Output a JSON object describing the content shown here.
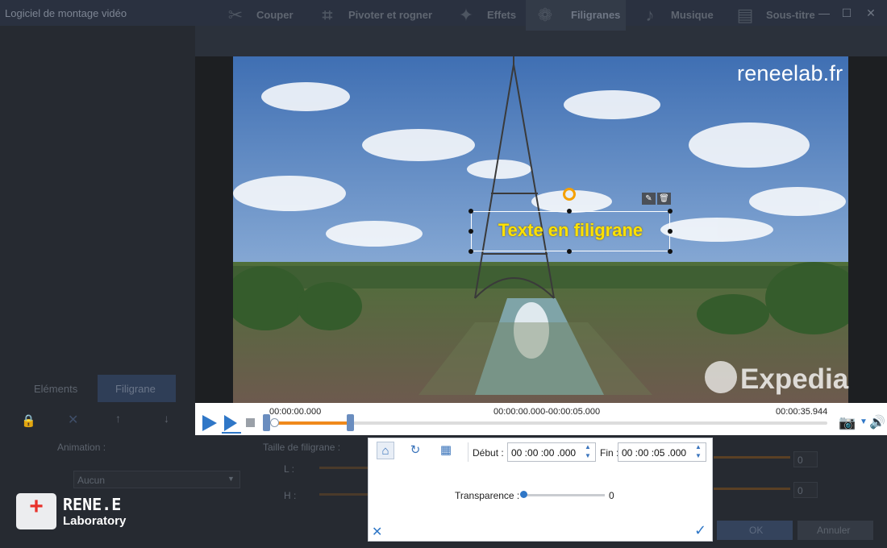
{
  "window": {
    "title": "Logiciel de montage vidéo",
    "min": "—",
    "max": "☐",
    "close": "✕"
  },
  "tabs": [
    {
      "label": "Couper",
      "icon": "scissors-icon"
    },
    {
      "label": "Pivoter et rogner",
      "icon": "crop-icon"
    },
    {
      "label": "Effets",
      "icon": "effects-icon"
    },
    {
      "label": "Filigranes",
      "icon": "watermark-icon"
    },
    {
      "label": "Musique",
      "icon": "music-icon"
    },
    {
      "label": "Sous-titre",
      "icon": "subtitle-icon"
    }
  ],
  "active_tab": "Filigranes",
  "preview": {
    "brand_watermark": "reneelab.fr",
    "video_logo": "Expedia",
    "watermark_text": "Texte en filigrane",
    "colors": {
      "watermark_text": "#ffe100",
      "selection": "#ffffff",
      "rotate_handle": "#f5a000"
    }
  },
  "player": {
    "time_start": "00:00:00.000",
    "time_range": "00:00:00.000-00:00:05.000",
    "time_end": "00:00:35.944",
    "progress": 0.0
  },
  "left_panel": {
    "tab_elements": "Eléments",
    "tab_watermark": "Filigrane",
    "animation_label": "Animation :",
    "animation_value": "Aucun",
    "size_label": "Taille de filigrane :",
    "l_label": "L :",
    "h_label": "H :"
  },
  "dialog": {
    "debut_label": "Début :",
    "debut_value": "00 :00 :00 .000",
    "fin_label": "Fin :",
    "fin_value": "00 :00 :05 .000",
    "transparence_label": "Transparence :",
    "transparence_value": "0"
  },
  "right_values": {
    "v1": "0",
    "v2": "0"
  },
  "footer": {
    "ok": "OK",
    "cancel": "Annuler"
  },
  "logo": {
    "line1": "RENE.E",
    "line2": "Laboratory"
  }
}
